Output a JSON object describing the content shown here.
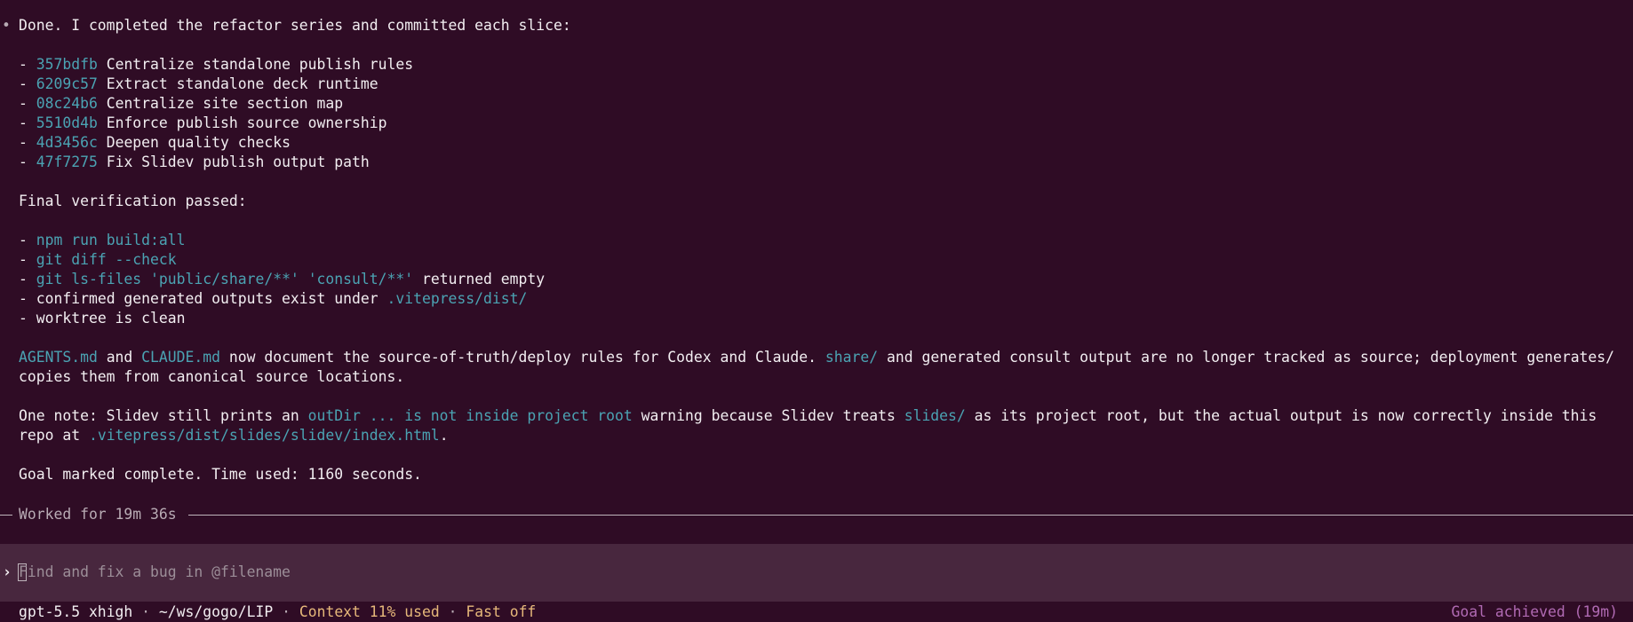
{
  "message": {
    "bullet": "•",
    "intro": "Done. I completed the refactor series and committed each slice:",
    "commits": [
      {
        "hash": "357bdfb",
        "text": "Centralize standalone publish rules"
      },
      {
        "hash": "6209c57",
        "text": "Extract standalone deck runtime"
      },
      {
        "hash": "08c24b6",
        "text": "Centralize site section map"
      },
      {
        "hash": "5510d4b",
        "text": "Enforce publish source ownership"
      },
      {
        "hash": "4d3456c",
        "text": "Deepen quality checks"
      },
      {
        "hash": "47f7275",
        "text": "Fix Slidev publish output path"
      }
    ],
    "verification_heading": "Final verification passed:",
    "verification": {
      "v1_code": "npm run build:all",
      "v2_code": "git diff --check",
      "v3_code_a": "git ls-files",
      "v3_code_b": "'public/share/**'",
      "v3_code_c": "'consult/**'",
      "v3_text": "returned empty",
      "v4_text": "confirmed generated outputs exist under",
      "v4_code": ".vitepress/dist/",
      "v5_text": "worktree is clean"
    },
    "paragraph1": {
      "code1": "AGENTS.md",
      "t1": "and",
      "code2": "CLAUDE.md",
      "t2": "now document the source-of-truth/deploy rules for Codex and Claude.",
      "code3": "share/",
      "t3": "and generated consult output are no longer tracked as source; deployment generates/",
      "line2": "copies them from canonical source locations."
    },
    "paragraph2": {
      "t1": "One note: Slidev still prints an",
      "code1": "outDir ... is not inside project root",
      "t2": "warning because Slidev treats",
      "code2": "slides/",
      "t3": "as its project root, but the actual output is now correctly inside this",
      "t4": "repo at",
      "code3": ".vitepress/dist/slides/slidev/index.html",
      "t5": "."
    },
    "goal_line": "Goal marked complete. Time used: 1160 seconds."
  },
  "worked": {
    "label": "Worked for 19m 36s"
  },
  "composer": {
    "arrow": "›",
    "placeholder": "Find and fix a bug in @filename",
    "value": ""
  },
  "status_bar": {
    "model": "gpt-5.5 xhigh",
    "separator": "·",
    "path": "~/ws/gogo/LIP",
    "context": "Context 11% used",
    "fast": "Fast off",
    "goal": "Goal achieved (19m)"
  },
  "colors": {
    "background": "#2f0c25",
    "composer_background": "#48273e",
    "code": "#4ba3b3",
    "status_accent": "#e6b87a",
    "goal": "#b06ab3"
  }
}
